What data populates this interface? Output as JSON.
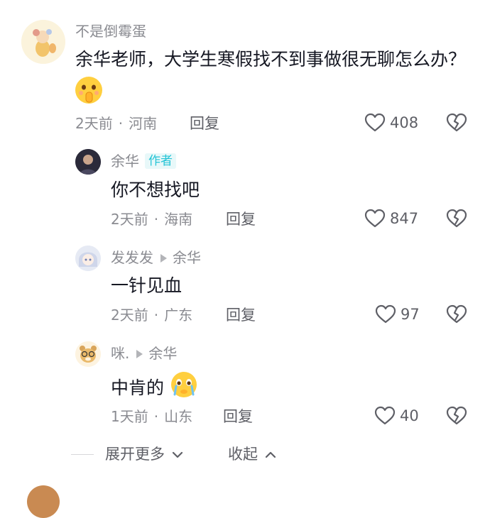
{
  "comments": [
    {
      "username": "不是倒霉蛋",
      "text": "余华老师，大学生寒假找不到事做很无聊怎么办？",
      "emoji": "shushing-face",
      "time": "2天前",
      "location": "河南",
      "reply_label": "回复",
      "likes": "408"
    },
    {
      "username": "余华",
      "author_tag": "作者",
      "text": "你不想找吧",
      "time": "2天前",
      "location": "海南",
      "reply_label": "回复",
      "likes": "847"
    },
    {
      "username": "发发发",
      "reply_to": "余华",
      "text": "一针见血",
      "time": "2天前",
      "location": "广东",
      "reply_label": "回复",
      "likes": "97"
    },
    {
      "username": "咪.",
      "reply_to": "余华",
      "text": "中肯的",
      "emoji": "crying-face",
      "time": "1天前",
      "location": "山东",
      "reply_label": "回复",
      "likes": "40"
    }
  ],
  "controls": {
    "expand_more": "展开更多",
    "collapse": "收起"
  },
  "colors": {
    "primary_text": "#161823",
    "secondary_text": "#8a8b91",
    "author_tag_bg": "#e8f8f9",
    "author_tag_text": "#25c4d6"
  }
}
